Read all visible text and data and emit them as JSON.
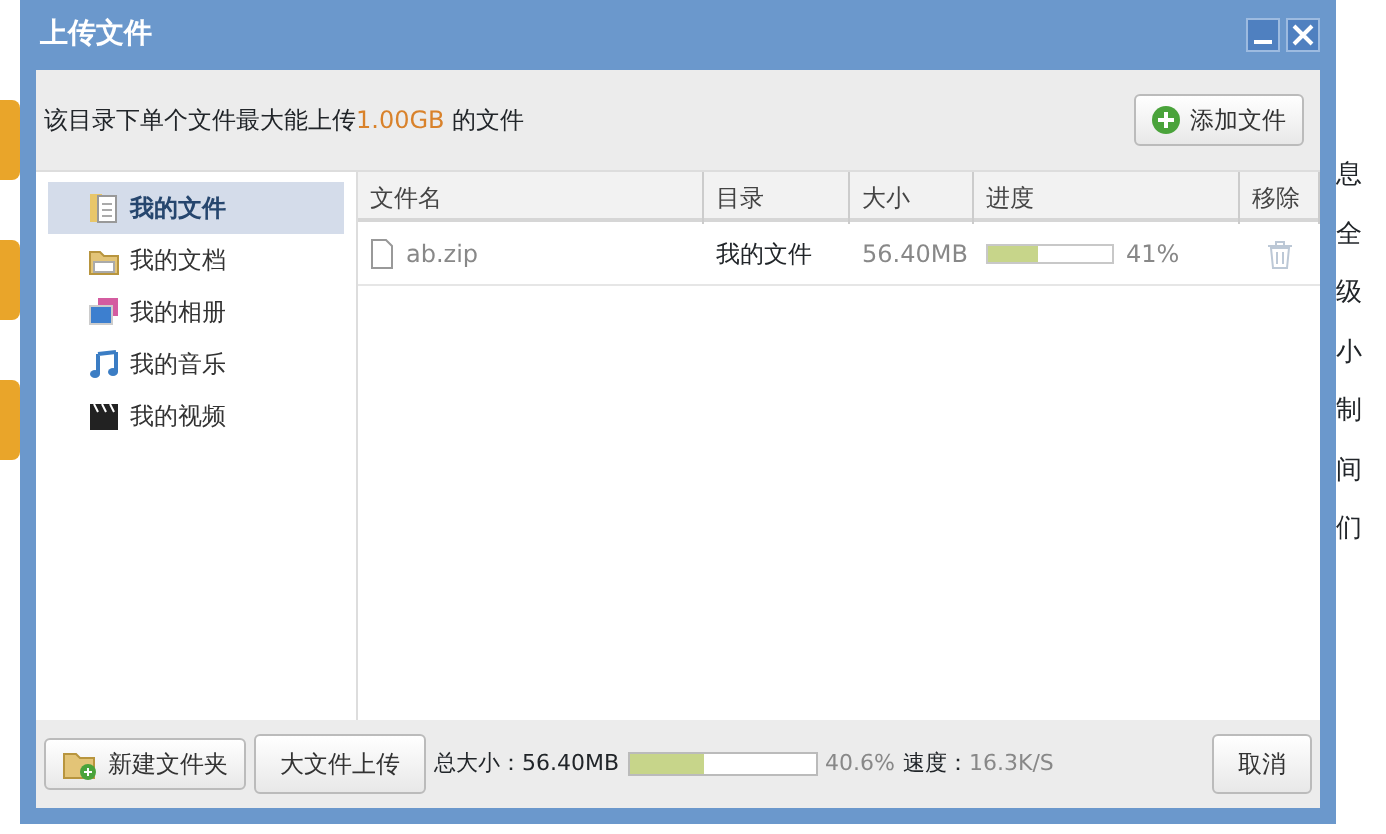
{
  "window": {
    "title": "上传文件"
  },
  "notice": {
    "text": "该目录下单个文件最大能上传",
    "limit": "1.00GB",
    "suffix": " 的文件"
  },
  "add_button": {
    "label": "添加文件"
  },
  "sidebar": {
    "items": [
      {
        "label": "我的文件",
        "kind": "files",
        "selected": true
      },
      {
        "label": "我的文档",
        "kind": "documents",
        "selected": false
      },
      {
        "label": "我的相册",
        "kind": "photos",
        "selected": false
      },
      {
        "label": "我的音乐",
        "kind": "music",
        "selected": false
      },
      {
        "label": "我的视频",
        "kind": "videos",
        "selected": false
      }
    ]
  },
  "table": {
    "columns": [
      "文件名",
      "目录",
      "大小",
      "进度",
      "移除"
    ],
    "rows": [
      {
        "name": "ab.zip",
        "folder": "我的文件",
        "size": "56.40MB",
        "level": 0.41,
        "percent": "41%"
      }
    ]
  },
  "footer": {
    "new_folder": "新建文件夹",
    "large_upload": "大文件上传",
    "total_label": "总大小：",
    "total": "56.40MB",
    "level": 0.406,
    "percent": "40.6%",
    "speed_label": "速度：",
    "speed": "16.3K/S",
    "cancel": "取消"
  },
  "background": {
    "side_texts": [
      "息",
      "全",
      "级",
      "小",
      "制",
      "间",
      "们"
    ]
  }
}
